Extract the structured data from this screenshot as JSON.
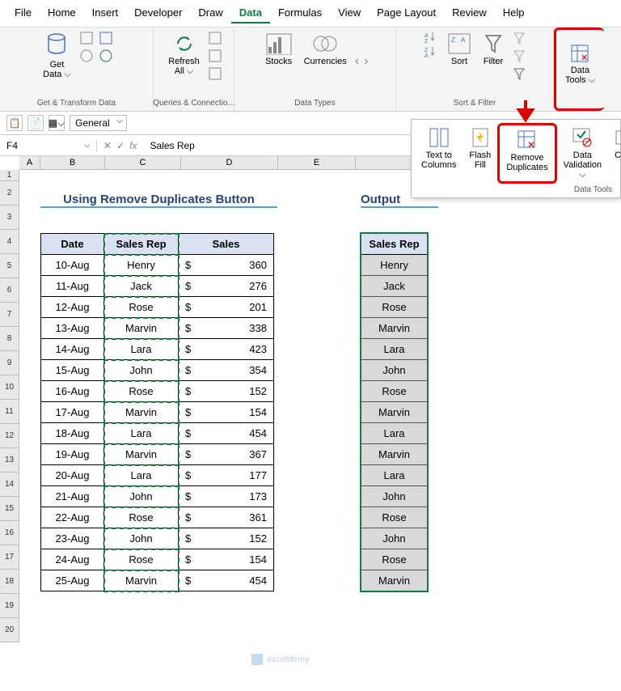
{
  "menu": [
    "File",
    "Home",
    "Insert",
    "Developer",
    "Draw",
    "Data",
    "Formulas",
    "View",
    "Page Layout",
    "Review",
    "Help"
  ],
  "menu_active": 5,
  "ribbon": {
    "get_data": "Get\nData ⌵",
    "group1": "Get & Transform Data",
    "refresh": "Refresh\nAll ⌵",
    "group2": "Queries & Connectio...",
    "stocks": "Stocks",
    "currencies": "Currencies",
    "group3": "Data Types",
    "sort": "Sort",
    "filter": "Filter",
    "group4": "Sort & Filter",
    "data_tools": "Data\nTools ⌵"
  },
  "format": "General",
  "namebox": "F4",
  "formula": "Sales Rep",
  "cols": [
    "A",
    "B",
    "C",
    "D",
    "E"
  ],
  "rows": [
    "1",
    "2",
    "3",
    "4",
    "5",
    "6",
    "7",
    "8",
    "9",
    "10",
    "11",
    "12",
    "13",
    "14",
    "15",
    "16",
    "17",
    "18",
    "19",
    "20"
  ],
  "title_main": "Using Remove Duplicates Button",
  "title_output": "Output",
  "headers": {
    "date": "Date",
    "rep": "Sales Rep",
    "sales": "Sales"
  },
  "data": [
    {
      "d": "10-Aug",
      "r": "Henry",
      "s": "360"
    },
    {
      "d": "11-Aug",
      "r": "Jack",
      "s": "276"
    },
    {
      "d": "12-Aug",
      "r": "Rose",
      "s": "201"
    },
    {
      "d": "13-Aug",
      "r": "Marvin",
      "s": "338"
    },
    {
      "d": "14-Aug",
      "r": "Lara",
      "s": "423"
    },
    {
      "d": "15-Aug",
      "r": "John",
      "s": "354"
    },
    {
      "d": "16-Aug",
      "r": "Rose",
      "s": "152"
    },
    {
      "d": "17-Aug",
      "r": "Marvin",
      "s": "154"
    },
    {
      "d": "18-Aug",
      "r": "Lara",
      "s": "454"
    },
    {
      "d": "19-Aug",
      "r": "Marvin",
      "s": "367"
    },
    {
      "d": "20-Aug",
      "r": "Lara",
      "s": "177"
    },
    {
      "d": "21-Aug",
      "r": "John",
      "s": "173"
    },
    {
      "d": "22-Aug",
      "r": "Rose",
      "s": "361"
    },
    {
      "d": "23-Aug",
      "r": "John",
      "s": "152"
    },
    {
      "d": "24-Aug",
      "r": "Rose",
      "s": "154"
    },
    {
      "d": "25-Aug",
      "r": "Marvin",
      "s": "454"
    }
  ],
  "output": [
    "Henry",
    "Jack",
    "Rose",
    "Marvin",
    "Lara",
    "John",
    "Rose",
    "Marvin",
    "Lara",
    "Marvin",
    "Lara",
    "John",
    "Rose",
    "John",
    "Rose",
    "Marvin"
  ],
  "dropdown": {
    "text_cols": "Text to\nColumns",
    "flash": "Flash\nFill",
    "remove": "Remove\nDuplicates",
    "validation": "Data\nValidation ⌵",
    "consol": "Co",
    "label": "Data Tools"
  },
  "watermark": "exceldemy"
}
